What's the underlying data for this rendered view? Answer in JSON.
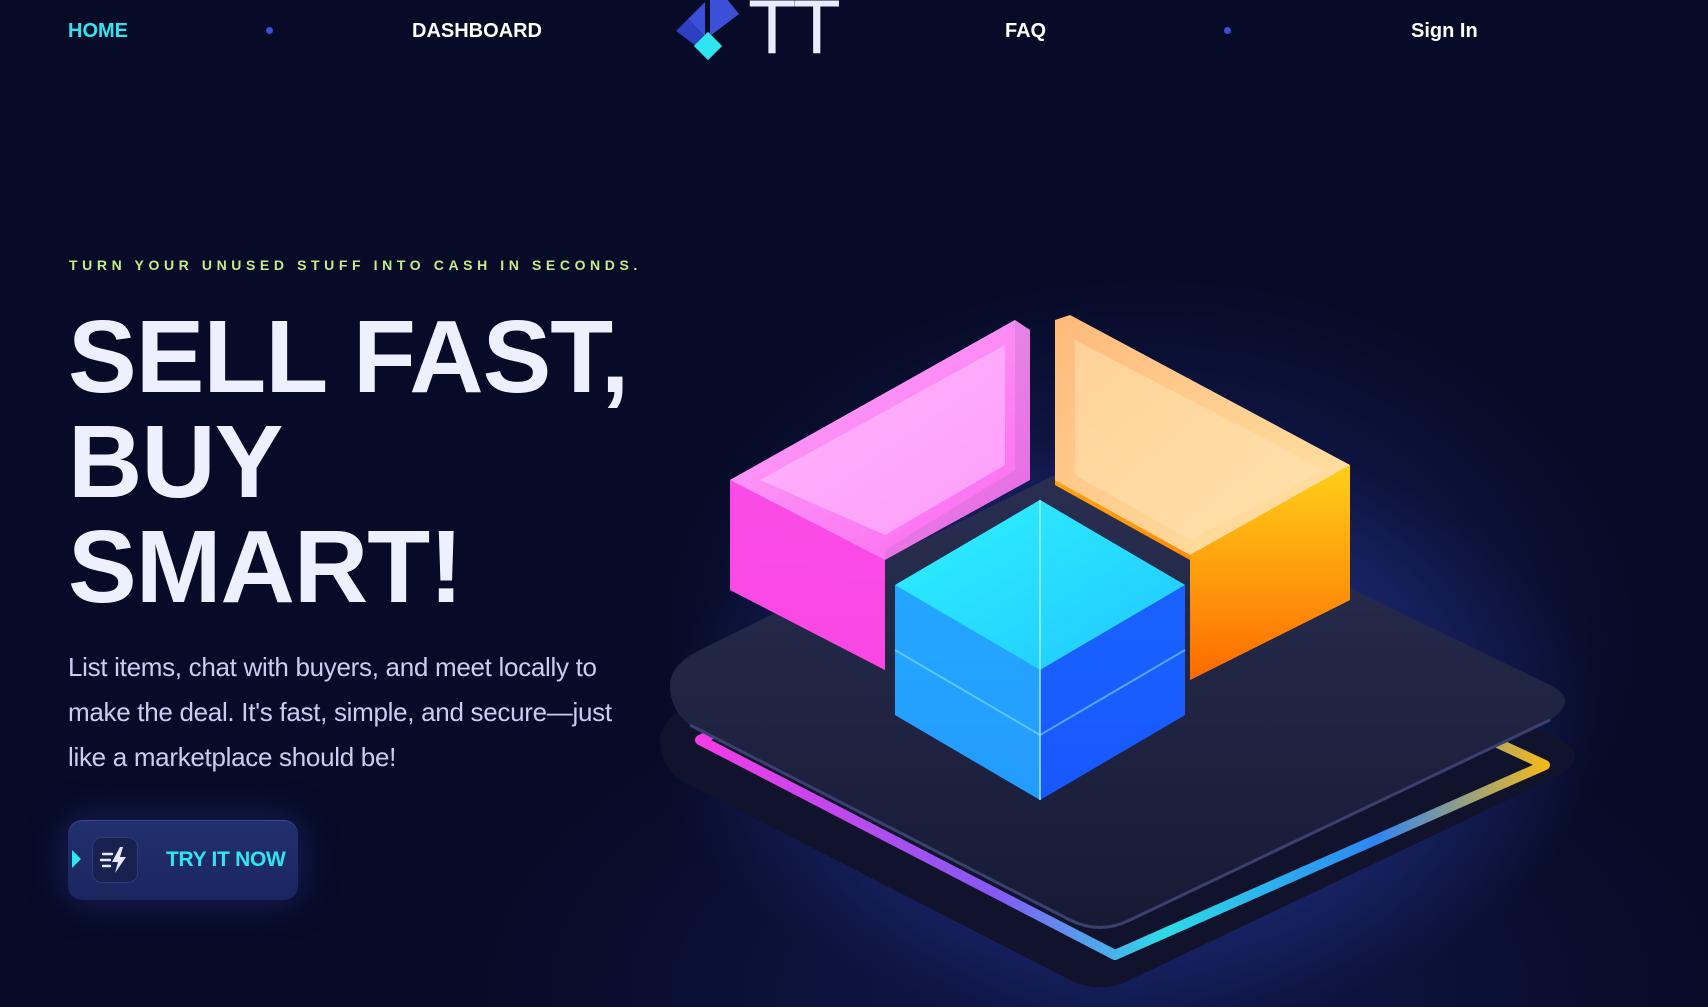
{
  "nav": {
    "home": "HOME",
    "dashboard": "DASHBOARD",
    "logo_text": "TT",
    "faq": "FAQ",
    "sign_in": "Sign In"
  },
  "hero": {
    "eyebrow": "TURN YOUR UNUSED STUFF INTO CASH IN SECONDS.",
    "headline_lines": [
      "SELL FAST,",
      "BUY",
      "SMART!"
    ],
    "description": "List items, chat with buyers, and meet locally to make the deal. It's fast, simple, and secure—just like a marketplace should be!",
    "cta_label": "TRY IT NOW",
    "cta_icon": "lightning-speed-icon"
  },
  "colors": {
    "background": "#070b27",
    "accent_cyan": "#2ee6f0",
    "eyebrow_green": "#c6ec86",
    "headline": "#eef0ff",
    "logo_blue": "#3b4fd8"
  }
}
